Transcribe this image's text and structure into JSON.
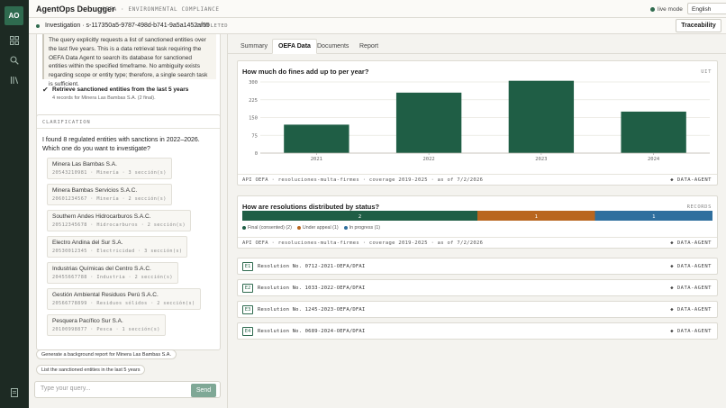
{
  "app": {
    "logo": "AO",
    "title": "AgentOps Debugger",
    "subtitle": "OEFA · ENVIRONMENTAL COMPLIANCE",
    "live_label": "live mode",
    "language": "English"
  },
  "investigation": {
    "title": "Investigation · s-117350a5-9787-498d-b741-9a5a1452af55",
    "status": "COMPLETED"
  },
  "traceability_label": "Traceability",
  "reasoning": {
    "text": "The query explicitly requests a list of sanctioned entities over the last five years. This is a data retrieval task requiring the OEFA Data Agent to search its database for sanctioned entities within the specified timeframe. No ambiguity exists regarding scope or entity type; therefore, a single search task is sufficient.",
    "result_title": "Retrieve sanctioned entities from the last 5 years",
    "result_sub": "4 records for Minera Las Bambas S.A. (2 final)."
  },
  "clarification": {
    "label": "CLARIFICATION",
    "question": "I found 8 regulated entities with sanctions in 2022–2026. Which one do you want to investigate?",
    "entities": [
      {
        "name": "Minera Las Bambas S.A.",
        "meta": "20543210981 · Minería · 3 sección(s)"
      },
      {
        "name": "Minera Bambas Servicios S.A.C.",
        "meta": "20601234567 · Minería · 2 sección(s)"
      },
      {
        "name": "Southern Andes Hidrocarburos S.A.C.",
        "meta": "20512345678 · Hidrocarburos · 2 sección(s)"
      },
      {
        "name": "Electro Andina del Sur S.A.",
        "meta": "20530012345 · Electricidad · 3 sección(s)"
      },
      {
        "name": "Industrias Químicas del Centro S.A.C.",
        "meta": "20455667788 · Industria · 2 sección(s)"
      },
      {
        "name": "Gestión Ambiental Residuos Perú S.A.C.",
        "meta": "20566778899 · Residuos sólidos · 2 sección(s)"
      },
      {
        "name": "Pesquera Pacífico Sur S.A.",
        "meta": "20100998877 · Pesca · 1 sección(s)"
      }
    ]
  },
  "suggestions": [
    "Generate a background report for Minera Las Bambas S.A.",
    "List the sanctioned entities in the last 5 years"
  ],
  "composer": {
    "placeholder": "Type your query...",
    "send_label": "Send"
  },
  "tabs": [
    "Summary",
    "OEFA Data",
    "Documents",
    "Report"
  ],
  "fines_panel": {
    "title": "How much do fines add up to per year?",
    "tag": "UIT",
    "source": "API OEFA · resoluciones-multa-firmes · coverage 2019-2025 · as of 7/2/2026",
    "agent": "◆ DATA-AGENT"
  },
  "status_panel": {
    "title": "How are resolutions distributed by status?",
    "tag": "RECORDS",
    "segments": [
      {
        "label": "Final (consented) (2)",
        "value": 2,
        "color": "#1f5e45"
      },
      {
        "label": "Under appeal (1)",
        "value": 1,
        "color": "#b9661f"
      },
      {
        "label": "In progress (1)",
        "value": 1,
        "color": "#2f6f9e"
      }
    ],
    "source": "API OEFA · resoluciones-multa-firmes · coverage 2019-2025 · as of 7/2/2026",
    "agent": "◆ DATA-AGENT"
  },
  "resolutions": [
    {
      "badge": "E1",
      "text": "Resolution No. 0712-2021-OEFA/DFAI",
      "agent": "◆ DATA-AGENT"
    },
    {
      "badge": "E2",
      "text": "Resolution No. 1033-2022-OEFA/DFAI",
      "agent": "◆ DATA-AGENT"
    },
    {
      "badge": "E3",
      "text": "Resolution No. 1245-2023-OEFA/DFAI",
      "agent": "◆ DATA-AGENT"
    },
    {
      "badge": "E4",
      "text": "Resolution No. 0689-2024-OEFA/DFAI",
      "agent": "◆ DATA-AGENT"
    }
  ],
  "chart_data": {
    "type": "bar",
    "categories": [
      "2021",
      "2022",
      "2023",
      "2024"
    ],
    "values": [
      120,
      255,
      305,
      175
    ],
    "ylim": [
      0,
      300
    ],
    "yticks": [
      "0",
      "75",
      "150",
      "225",
      "300"
    ],
    "color": "#1f5e45",
    "grid": true
  },
  "colors": {
    "accent": "#2f6b4f",
    "rail": "#1d2a23"
  }
}
